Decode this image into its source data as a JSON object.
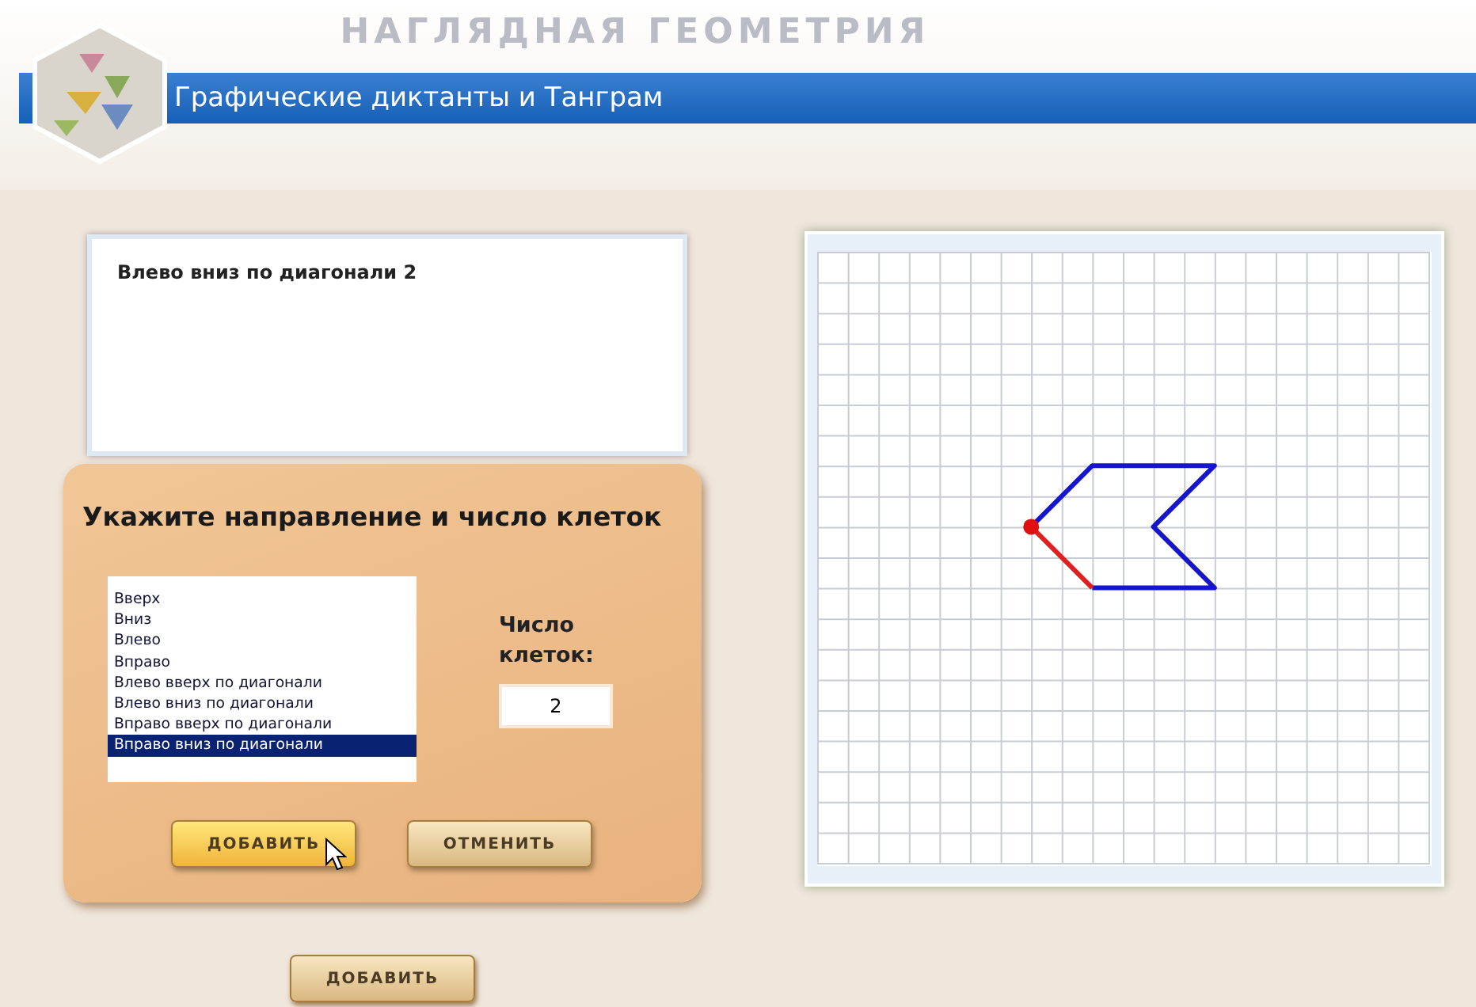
{
  "app_title": "НАГЛЯДНАЯ ГЕОМЕТРИЯ",
  "section_title": "Графические диктанты и Танграм",
  "log": {
    "lines": [
      "Влево вниз по диагонали 2"
    ]
  },
  "dialog": {
    "title": "Укажите направление и число клеток",
    "directions": [
      {
        "label": "Вверх",
        "selected": false
      },
      {
        "label": "Вниз",
        "selected": false
      },
      {
        "label": "Влево",
        "selected": false
      },
      {
        "label": "Вправо",
        "selected": false
      },
      {
        "label": "Влево вверх по диагонали",
        "selected": false
      },
      {
        "label": "Влево вниз по диагонали",
        "selected": false
      },
      {
        "label": "Вправо вверх по диагонали",
        "selected": false
      },
      {
        "label": "Вправо вниз по диагонали",
        "selected": true
      }
    ],
    "count_label": "Число клеток:",
    "count_value": "2",
    "buttons": [
      {
        "label": "ДОБАВИТЬ",
        "hovered": true
      },
      {
        "label": "ОТМЕНИТЬ",
        "hovered": false
      }
    ]
  },
  "add_button": {
    "label": "ДОБАВИТЬ"
  }
}
